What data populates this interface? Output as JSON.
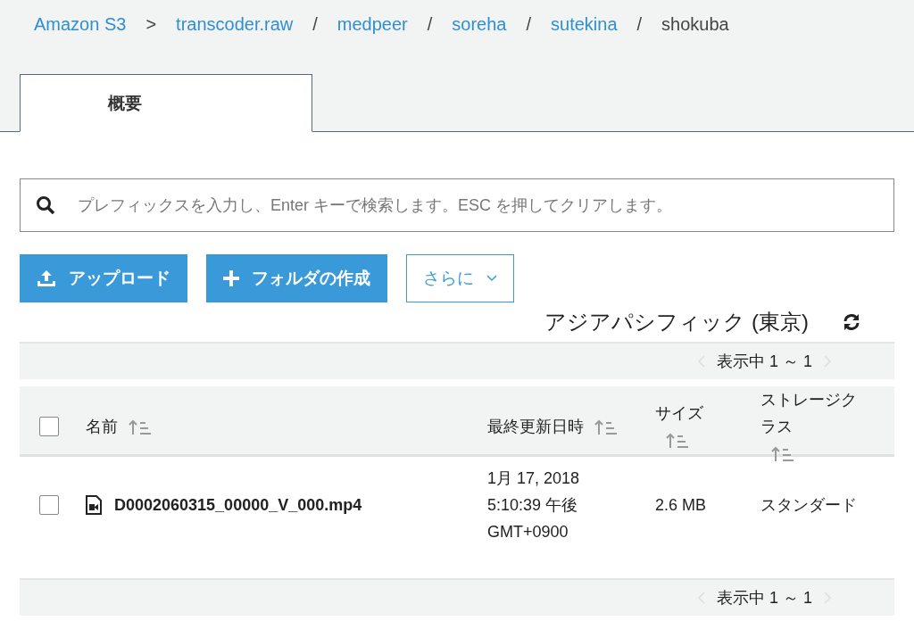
{
  "breadcrumbs": [
    {
      "label": "Amazon S3",
      "link": true
    },
    {
      "sep": ">",
      "label": "transcoder.raw",
      "link": true
    },
    {
      "sep": "/",
      "label": "medpeer",
      "link": true
    },
    {
      "sep": "/",
      "label": "soreha",
      "link": true
    },
    {
      "sep": "/",
      "label": "sutekina",
      "link": true
    },
    {
      "sep": "/",
      "label": "shokuba",
      "link": false
    }
  ],
  "tabs": [
    {
      "label": "概要",
      "selected": true
    }
  ],
  "search": {
    "placeholder": "プレフィックスを入力し、Enter キーで検索します。ESC を押してクリアします。"
  },
  "buttons": [
    {
      "kind": "upload",
      "label": "アップロード"
    },
    {
      "kind": "folder",
      "label": "フォルダの作成"
    },
    {
      "kind": "more",
      "label": "さらに"
    }
  ],
  "region": "アジアパシフィック (東京)",
  "pager_top": "表示中 1 ～ 1",
  "table": {
    "select_all": false,
    "columns": [
      {
        "label": "名前"
      },
      {
        "label": "最終更新日時"
      },
      {
        "label": "サイズ"
      },
      {
        "label": "ストレージクラス"
      }
    ],
    "rows": [
      {
        "checked": false,
        "name": "D0002060315_00000_V_000.mp4",
        "modified": [
          "1月 17, 2018",
          "5:10:39 午後",
          "GMT+0900"
        ],
        "size": "2.6 MB",
        "storage": "スタンダード"
      }
    ]
  },
  "pager_bottom": "表示中 1 ～ 1"
}
